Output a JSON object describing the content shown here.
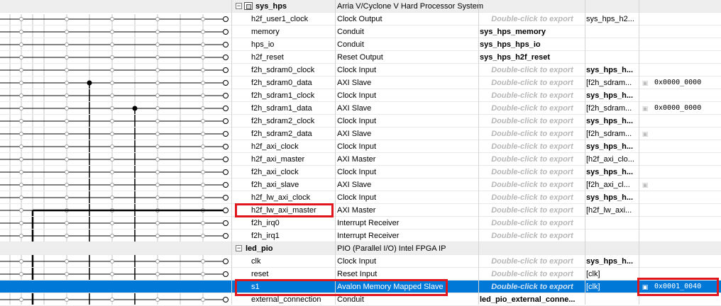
{
  "rows": [
    {
      "kind": "group",
      "name": "sys_hps",
      "desc": "Arria V/Cyclone V Hard Processor System",
      "export": "",
      "clock": "",
      "base": "",
      "lock": false
    },
    {
      "kind": "iface",
      "name": "h2f_user1_clock",
      "desc": "Clock Output",
      "export": "Double-click to export",
      "exportHint": true,
      "clock": "sys_hps_h2...",
      "clockBold": false,
      "base": "",
      "lock": false
    },
    {
      "kind": "iface",
      "name": "memory",
      "desc": "Conduit",
      "export": "sys_hps_memory",
      "exportHint": false,
      "clock": "",
      "base": "",
      "lock": false
    },
    {
      "kind": "iface",
      "name": "hps_io",
      "desc": "Conduit",
      "export": "sys_hps_hps_io",
      "exportHint": false,
      "clock": "",
      "base": "",
      "lock": false
    },
    {
      "kind": "iface",
      "name": "h2f_reset",
      "desc": "Reset Output",
      "export": "sys_hps_h2f_reset",
      "exportHint": false,
      "clock": "",
      "base": "",
      "lock": false
    },
    {
      "kind": "iface",
      "name": "f2h_sdram0_clock",
      "desc": "Clock Input",
      "export": "Double-click to export",
      "exportHint": true,
      "clock": "sys_hps_h...",
      "clockBold": true,
      "base": "",
      "lock": false
    },
    {
      "kind": "iface",
      "name": "f2h_sdram0_data",
      "desc": "AXI Slave",
      "export": "Double-click to export",
      "exportHint": true,
      "clock": "[f2h_sdram...",
      "clockBold": false,
      "base": "0x0000_0000",
      "lock": true
    },
    {
      "kind": "iface",
      "name": "f2h_sdram1_clock",
      "desc": "Clock Input",
      "export": "Double-click to export",
      "exportHint": true,
      "clock": "sys_hps_h...",
      "clockBold": true,
      "base": "",
      "lock": false
    },
    {
      "kind": "iface",
      "name": "f2h_sdram1_data",
      "desc": "AXI Slave",
      "export": "Double-click to export",
      "exportHint": true,
      "clock": "[f2h_sdram...",
      "clockBold": false,
      "base": "0x0000_0000",
      "lock": true
    },
    {
      "kind": "iface",
      "name": "f2h_sdram2_clock",
      "desc": "Clock Input",
      "export": "Double-click to export",
      "exportHint": true,
      "clock": "sys_hps_h...",
      "clockBold": true,
      "base": "",
      "lock": false
    },
    {
      "kind": "iface",
      "name": "f2h_sdram2_data",
      "desc": "AXI Slave",
      "export": "Double-click to export",
      "exportHint": true,
      "clock": "[f2h_sdram...",
      "clockBold": false,
      "base": "",
      "lock": true
    },
    {
      "kind": "iface",
      "name": "h2f_axi_clock",
      "desc": "Clock Input",
      "export": "Double-click to export",
      "exportHint": true,
      "clock": "sys_hps_h...",
      "clockBold": true,
      "base": "",
      "lock": false
    },
    {
      "kind": "iface",
      "name": "h2f_axi_master",
      "desc": "AXI Master",
      "export": "Double-click to export",
      "exportHint": true,
      "clock": "[h2f_axi_clo...",
      "clockBold": false,
      "base": "",
      "lock": false
    },
    {
      "kind": "iface",
      "name": "f2h_axi_clock",
      "desc": "Clock Input",
      "export": "Double-click to export",
      "exportHint": true,
      "clock": "sys_hps_h...",
      "clockBold": true,
      "base": "",
      "lock": false
    },
    {
      "kind": "iface",
      "name": "f2h_axi_slave",
      "desc": "AXI Slave",
      "export": "Double-click to export",
      "exportHint": true,
      "clock": "[f2h_axi_cl...",
      "clockBold": false,
      "base": "",
      "lock": true
    },
    {
      "kind": "iface",
      "name": "h2f_lw_axi_clock",
      "desc": "Clock Input",
      "export": "Double-click to export",
      "exportHint": true,
      "clock": "sys_hps_h...",
      "clockBold": true,
      "base": "",
      "lock": false
    },
    {
      "kind": "iface",
      "name": "h2f_lw_axi_master",
      "desc": "AXI Master",
      "export": "Double-click to export",
      "exportHint": true,
      "clock": "[h2f_lw_axi...",
      "clockBold": false,
      "base": "",
      "lock": false
    },
    {
      "kind": "iface",
      "name": "f2h_irq0",
      "desc": "Interrupt Receiver",
      "export": "Double-click to export",
      "exportHint": true,
      "clock": "",
      "base": "",
      "lock": false
    },
    {
      "kind": "iface",
      "name": "f2h_irq1",
      "desc": "Interrupt Receiver",
      "export": "Double-click to export",
      "exportHint": true,
      "clock": "",
      "base": "",
      "lock": false
    },
    {
      "kind": "group",
      "name": "led_pio",
      "desc": "PIO (Parallel I/O) Intel FPGA IP",
      "export": "",
      "clock": "",
      "base": "",
      "lock": false
    },
    {
      "kind": "iface",
      "name": "clk",
      "desc": "Clock Input",
      "export": "Double-click to export",
      "exportHint": true,
      "clock": "sys_hps_h...",
      "clockBold": true,
      "base": "",
      "lock": false
    },
    {
      "kind": "iface",
      "name": "reset",
      "desc": "Reset Input",
      "export": "Double-click to export",
      "exportHint": true,
      "clock": "[clk]",
      "clockBold": false,
      "base": "",
      "lock": false
    },
    {
      "kind": "iface",
      "name": "s1",
      "desc": "Avalon Memory Mapped Slave",
      "export": "Double-click to export",
      "exportHint": true,
      "clock": "[clk]",
      "clockBold": false,
      "base": "0x0001_0040",
      "lock": true,
      "selected": true
    },
    {
      "kind": "iface",
      "name": "external_connection",
      "desc": "Conduit",
      "export": "led_pio_external_conne...",
      "exportHint": false,
      "clock": "",
      "base": "",
      "lock": false
    }
  ],
  "highlights": [
    "h2f_lw_axi_master-name",
    "s1-name-desc",
    "s1-base"
  ],
  "colors": {
    "selection": "#0078d7",
    "highlight": "#e0161d",
    "wire": "#000000",
    "wire_inactive": "#bdbdbd"
  },
  "icons": {
    "expand": "minus-toggle-icon",
    "component": "component-icon",
    "lock": "lock-icon"
  }
}
